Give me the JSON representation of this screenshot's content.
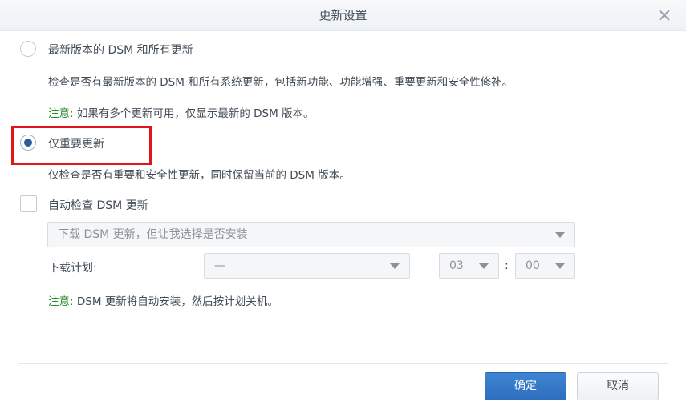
{
  "dialog": {
    "title": "更新设置",
    "close_icon": "close-icon"
  },
  "options": {
    "latest": {
      "label": "最新版本的 DSM 和所有更新",
      "description": "检查是否有最新版本的 DSM 和所有系统更新，包括新功能、功能增强、重要更新和安全性修补。",
      "note_label": "注意:",
      "note_text": " 如果有多个更新可用，仅显示最新的 DSM 版本。",
      "selected": false
    },
    "important": {
      "label": "仅重要更新",
      "description": "仅检查是否有重要和安全性更新，同时保留当前的 DSM 版本。",
      "selected": true
    }
  },
  "auto_check": {
    "label": "自动检查 DSM 更新",
    "checked": false,
    "mode_select": {
      "value": "下载 DSM 更新，但让我选择是否安装"
    },
    "schedule": {
      "label": "下载计划:",
      "day_value": "—",
      "hour_value": "03",
      "separator": ":",
      "minute_value": "00"
    },
    "note_label": "注意:",
    "note_text": " DSM 更新将自动安装，然后按计划关机。"
  },
  "footer": {
    "ok_label": "确定",
    "cancel_label": "取消"
  },
  "colors": {
    "primary": "#2e6ebe",
    "note_green": "#2b8b2b",
    "highlight_red": "#e0161c"
  }
}
